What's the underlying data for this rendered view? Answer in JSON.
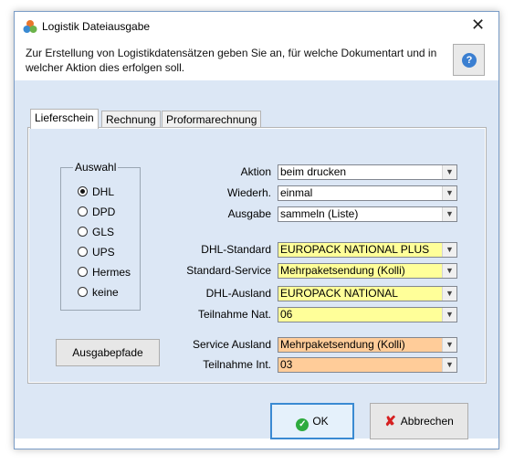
{
  "window": {
    "title": "Logistik Dateiausgabe",
    "close_glyph": "✕"
  },
  "header": {
    "text": "Zur Erstellung von Logistikdatensätzen geben Sie an, für welche Dokumentart und in welcher Aktion dies erfolgen soll.",
    "help_glyph": "?"
  },
  "tabs": [
    {
      "label": "Lieferschein",
      "active": true
    },
    {
      "label": "Rechnung",
      "active": false
    },
    {
      "label": "Proformarechnung",
      "active": false
    }
  ],
  "auswahl": {
    "legend": "Auswahl",
    "options": [
      {
        "label": "DHL",
        "checked": true
      },
      {
        "label": "DPD",
        "checked": false
      },
      {
        "label": "GLS",
        "checked": false
      },
      {
        "label": "UPS",
        "checked": false
      },
      {
        "label": "Hermes",
        "checked": false
      },
      {
        "label": "keine",
        "checked": false
      }
    ]
  },
  "buttons": {
    "ausgabepfade": "Ausgabepfade",
    "ok": "OK",
    "abbrechen": "Abbrechen"
  },
  "fields": {
    "aktion": {
      "label": "Aktion",
      "value": "beim drucken"
    },
    "wiederh": {
      "label": "Wiederh.",
      "value": "einmal"
    },
    "ausgabe": {
      "label": "Ausgabe",
      "value": "sammeln (Liste)"
    },
    "dhl_standard": {
      "label": "DHL-Standard",
      "value": "EUROPACK NATIONAL PLUS"
    },
    "standard_service": {
      "label": "Standard-Service",
      "value": "Mehrpaketsendung (Kolli)"
    },
    "dhl_ausland": {
      "label": "DHL-Ausland",
      "value": "EUROPACK NATIONAL"
    },
    "teilnahme_nat": {
      "label": "Teilnahme Nat.",
      "value": "06"
    },
    "service_ausland": {
      "label": "Service Ausland",
      "value": "Mehrpaketsendung (Kolli)"
    },
    "teilnahme_int": {
      "label": "Teilnahme Int.",
      "value": "03"
    }
  },
  "colors": {
    "panel_bg": "#dce7f5",
    "field_yellow": "#ffff99",
    "field_orange": "#ffcc99",
    "accent_blue": "#3a8ad2"
  }
}
